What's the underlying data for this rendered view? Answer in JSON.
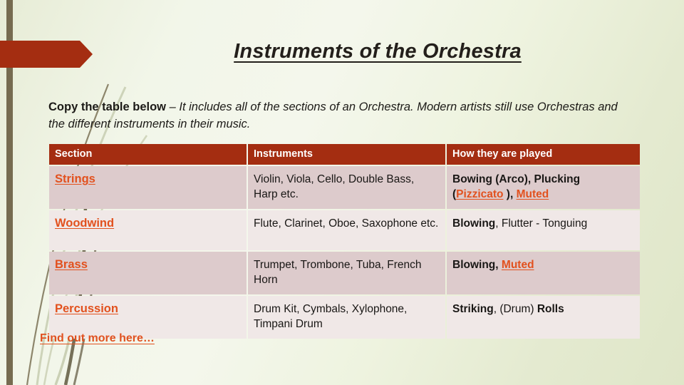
{
  "slide": {
    "title": "Instruments of the Orchestra",
    "intro_lead": "Copy the table below ",
    "intro_rest": "– It includes all of the sections of an Orchestra. Modern artists still use Orchestras and the different instruments in their music.",
    "footer_link": "Find out more here…"
  },
  "colors": {
    "header_fill": "#a42d11",
    "row_shade": "#ddcbcc",
    "row_light": "#f0e8e7",
    "link": "#e2511e",
    "accent_bar": "#766b50",
    "arrow": "#a42d11",
    "background_light": "#f4f7ec",
    "background_green": "#dfe6c8"
  },
  "table": {
    "headers": [
      "Section",
      "Instruments",
      "How they are played"
    ],
    "rows": [
      {
        "section": "Strings",
        "instruments": "Violin, Viola, Cello, Double Bass, Harp etc.",
        "played": {
          "part1": "Bowing (Arco), Plucking",
          "part2": "(",
          "link1": "Pizzicato",
          "part3": " ), ",
          "link2": "Muted"
        }
      },
      {
        "section": "Woodwind",
        "instruments": "Flute, Clarinet, Oboe, Saxophone etc.",
        "played": {
          "part1": "Blowing",
          "part2": ", Flutter - Tonguing",
          "link1": "",
          "part3": "",
          "link2": ""
        }
      },
      {
        "section": "Brass",
        "instruments": "Trumpet, Trombone, Tuba, French Horn",
        "played": {
          "part1": "Blowing",
          "part2": ", ",
          "link1": "",
          "part3": "",
          "link2": "Muted"
        }
      },
      {
        "section": "Percussion",
        "instruments": "Drum Kit, Cymbals, Xylophone, Timpani Drum",
        "played": {
          "part1": "Striking",
          "part2": ", (Drum) ",
          "link1": "",
          "part3": "",
          "link2": ""
        }
      }
    ],
    "row4_played_bold_tail": "Rolls"
  }
}
